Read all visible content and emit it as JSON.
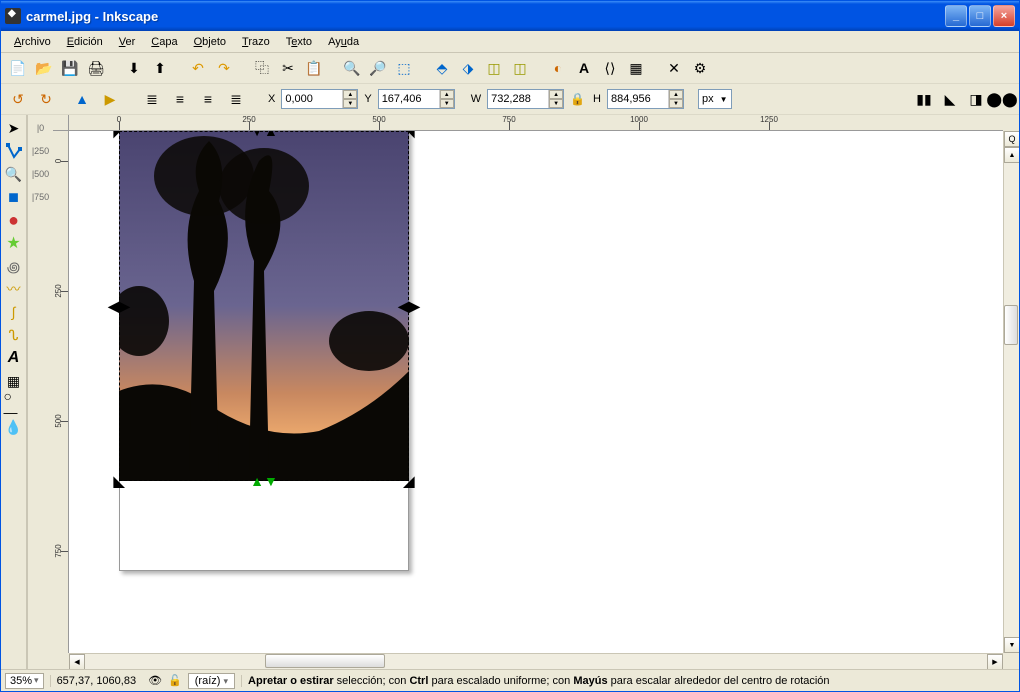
{
  "title": "carmel.jpg - Inkscape",
  "menus": [
    "Archivo",
    "Edición",
    "Ver",
    "Capa",
    "Objeto",
    "Trazo",
    "Texto",
    "Ayuda"
  ],
  "coords": {
    "x_label": "X",
    "x": "0,000",
    "y_label": "Y",
    "y": "167,406",
    "w_label": "W",
    "w": "732,288",
    "h_label": "H",
    "h": "884,956",
    "unit": "px"
  },
  "ruler_h": [
    0,
    250,
    500,
    750,
    1000,
    1250
  ],
  "ruler_v": [
    0,
    250,
    500,
    750
  ],
  "status": {
    "zoom": "35%",
    "cursor": "657,37, 1060,83",
    "layer": "(raíz)",
    "message": "Apretar o estirar selección; con Ctrl para escalado uniforme; con Mayús para escalar alrededor del centro de rotación"
  },
  "tools": {
    "select": "▲",
    "node": "✎",
    "zoom": "🔍",
    "rect": "■",
    "circle": "●",
    "star": "★",
    "spiral": "◉",
    "freehand": "✐",
    "bezier": "∿",
    "calligraphy": "〰",
    "text": "A",
    "gradient": "▤",
    "dropper": "✎",
    "connector": "⟶"
  }
}
